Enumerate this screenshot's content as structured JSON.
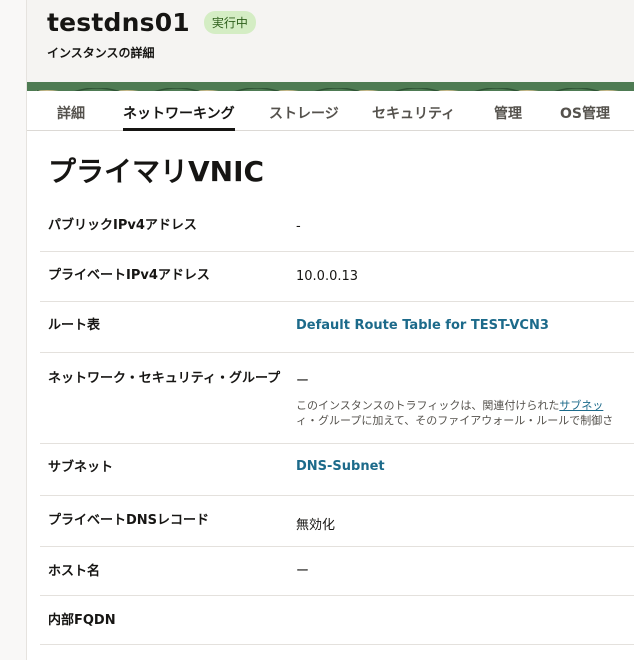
{
  "header": {
    "title": "testdns01",
    "status_badge": "実行中",
    "subtitle": "インスタンスの詳細"
  },
  "tabs": [
    {
      "label": "詳細"
    },
    {
      "label": "ネットワーキング"
    },
    {
      "label": "ストレージ"
    },
    {
      "label": "セキュリティ"
    },
    {
      "label": "管理"
    },
    {
      "label": "OS管理"
    }
  ],
  "active_tab": "ネットワーキング",
  "section": {
    "title": "プライマリVNIC"
  },
  "fields": [
    {
      "label": "パブリックIPv4アドレス",
      "value": "-"
    },
    {
      "label": "プライベートIPv4アドレス",
      "value": "10.0.0.13"
    },
    {
      "label": "ルート表",
      "value": "Default Route Table for TEST-VCN3"
    },
    {
      "label": "ネットワーク・セキュリティ・グループ",
      "value": "ー",
      "desc_line1_prefix": "このインスタンスのトラフィックは、関連付けられた",
      "desc_line1_link": "サブネッ",
      "desc_line2": "ィ・グループに加えて、そのファイアウォール・ルールで制御さ"
    },
    {
      "label": "サブネット",
      "value": "DNS-Subnet"
    },
    {
      "label": "プライベートDNSレコード",
      "value": "無効化"
    },
    {
      "label": "ホスト名",
      "value": "ー"
    },
    {
      "label": "内部FQDN",
      "value": ""
    }
  ],
  "colors": {
    "badge_bg": "#d4edc4",
    "link": "#1c6a8a",
    "banner": "#4e7b53"
  }
}
